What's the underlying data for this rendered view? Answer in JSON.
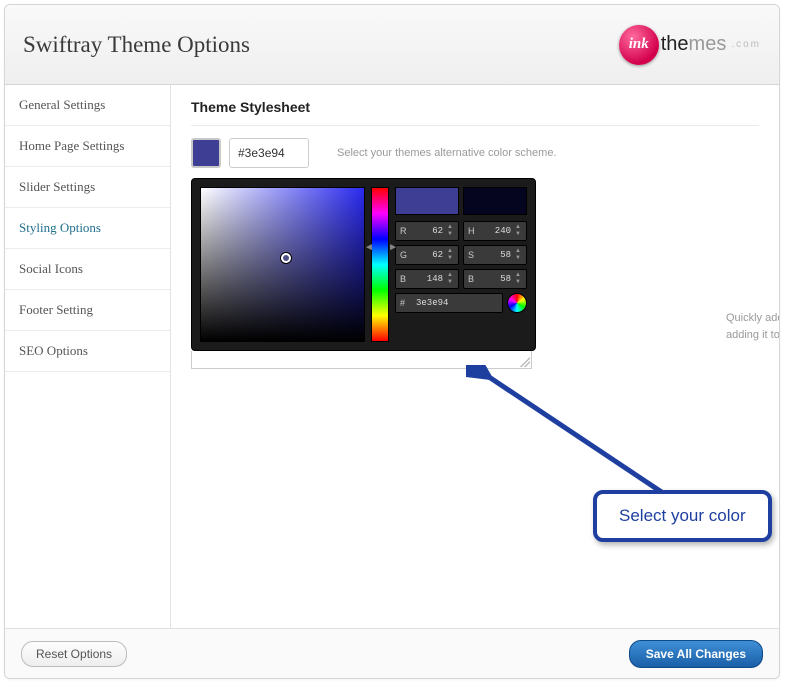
{
  "header": {
    "title": "Swiftray Theme Options",
    "logo_mark": "ink",
    "logo_word_main": "the",
    "logo_word_light": "mes",
    "logo_suffix": ".com"
  },
  "sidebar": {
    "items": [
      {
        "label": "General Settings",
        "active": false
      },
      {
        "label": "Home Page Settings",
        "active": false
      },
      {
        "label": "Slider Settings",
        "active": false
      },
      {
        "label": "Styling Options",
        "active": true
      },
      {
        "label": "Social Icons",
        "active": false
      },
      {
        "label": "Footer Setting",
        "active": false
      },
      {
        "label": "SEO Options",
        "active": false
      }
    ]
  },
  "main": {
    "section_title": "Theme Stylesheet",
    "color_hex_input": "#3e3e94",
    "swatch_color": "#3e3e94",
    "scheme_hint": "Select your themes alternative color scheme.",
    "css_hint": "Quickly add some CSS to your theme by adding it to this block."
  },
  "picker": {
    "r": "62",
    "g": "62",
    "b": "148",
    "h": "240",
    "s": "58",
    "bval": "58",
    "hex": "3e3e94",
    "preview_new": "#3e3e94",
    "preview_old": "#050520"
  },
  "callout": {
    "text": "Select your color"
  },
  "footer": {
    "reset_label": "Reset Options",
    "save_label": "Save All Changes"
  }
}
